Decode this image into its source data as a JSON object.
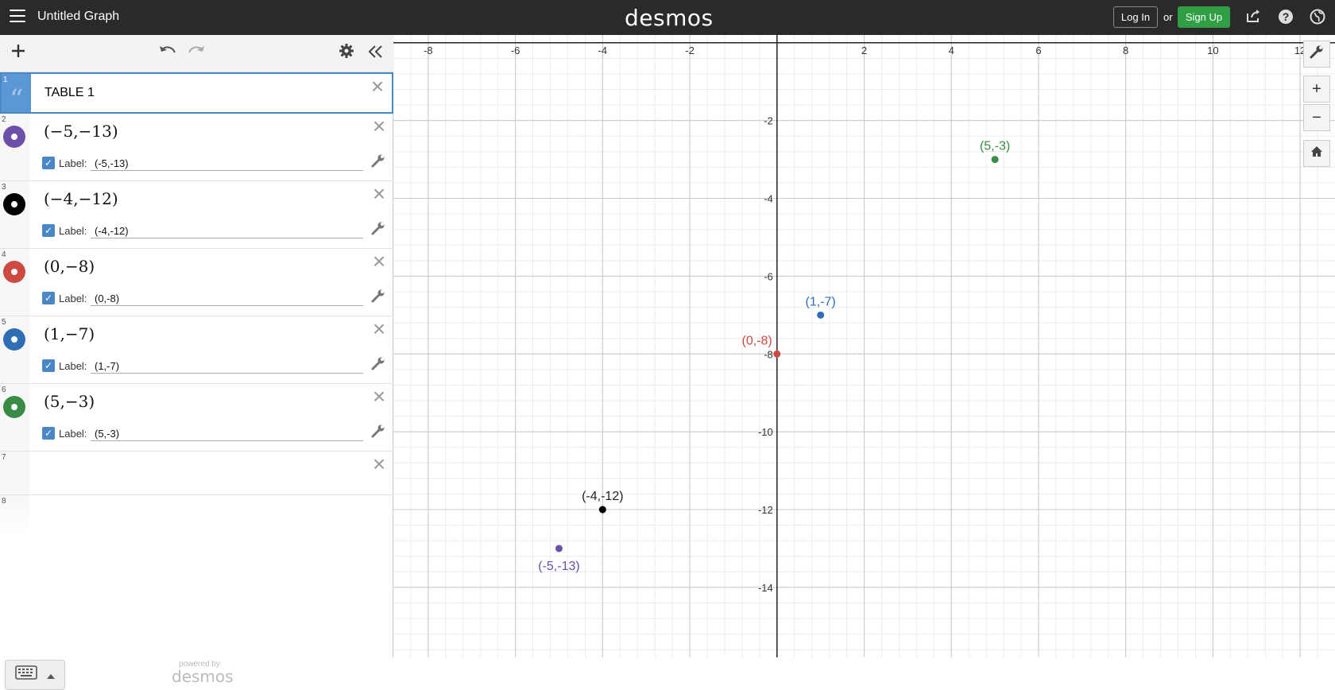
{
  "header": {
    "title": "Untitled Graph",
    "brand": "desmos",
    "login_label": "Log In",
    "or_text": "or",
    "signup_label": "Sign Up"
  },
  "colors": {
    "purple": "#6b4fa8",
    "black": "#000000",
    "red": "#cd4a40",
    "blue": "#2f6db5",
    "green": "#388c46",
    "signup": "#2f9e44"
  },
  "expressions": [
    {
      "num": "1",
      "type": "table",
      "title": "TABLE 1"
    },
    {
      "num": "2",
      "math": "(−5,−13)",
      "label_text": "Label:",
      "label_value": "(-5,-13)",
      "color": "#6b4fa8"
    },
    {
      "num": "3",
      "math": "(−4,−12)",
      "label_text": "Label:",
      "label_value": "(-4,-12)",
      "color": "#000000"
    },
    {
      "num": "4",
      "math": "(0,−8)",
      "label_text": "Label:",
      "label_value": "(0,-8)",
      "color": "#cd4a40"
    },
    {
      "num": "5",
      "math": "(1,−7)",
      "label_text": "Label:",
      "label_value": "(1,-7)",
      "color": "#2f6db5"
    },
    {
      "num": "6",
      "math": "(5,−3)",
      "label_text": "Label:",
      "label_value": "(5,-3)",
      "color": "#388c46"
    },
    {
      "num": "7"
    },
    {
      "num": "8"
    }
  ],
  "footer": {
    "powered_by": "powered by",
    "powered_brand": "desmos"
  },
  "chart_data": {
    "type": "scatter",
    "x_range": [
      -8.8,
      12.8
    ],
    "y_range": [
      -15.8,
      0.2
    ],
    "x_ticks": [
      "-8",
      "-6",
      "-4",
      "-2",
      "2",
      "4",
      "6",
      "8",
      "10",
      "12"
    ],
    "y_ticks": [
      "-2",
      "-4",
      "-6",
      "-8",
      "-10",
      "-12",
      "-14"
    ],
    "grid": true,
    "points": [
      {
        "x": -5,
        "y": -13,
        "label": "(-5,-13)",
        "color": "#6b4fa8",
        "label_pos": "below"
      },
      {
        "x": -4,
        "y": -12,
        "label": "(-4,-12)",
        "color": "#000000",
        "label_pos": "above"
      },
      {
        "x": 0,
        "y": -8,
        "label": "(0,-8)",
        "color": "#cd4a40",
        "label_pos": "above-left"
      },
      {
        "x": 1,
        "y": -7,
        "label": "(1,-7)",
        "color": "#2f6db5",
        "label_pos": "above"
      },
      {
        "x": 5,
        "y": -3,
        "label": "(5,-3)",
        "color": "#388c46",
        "label_pos": "above"
      }
    ]
  }
}
